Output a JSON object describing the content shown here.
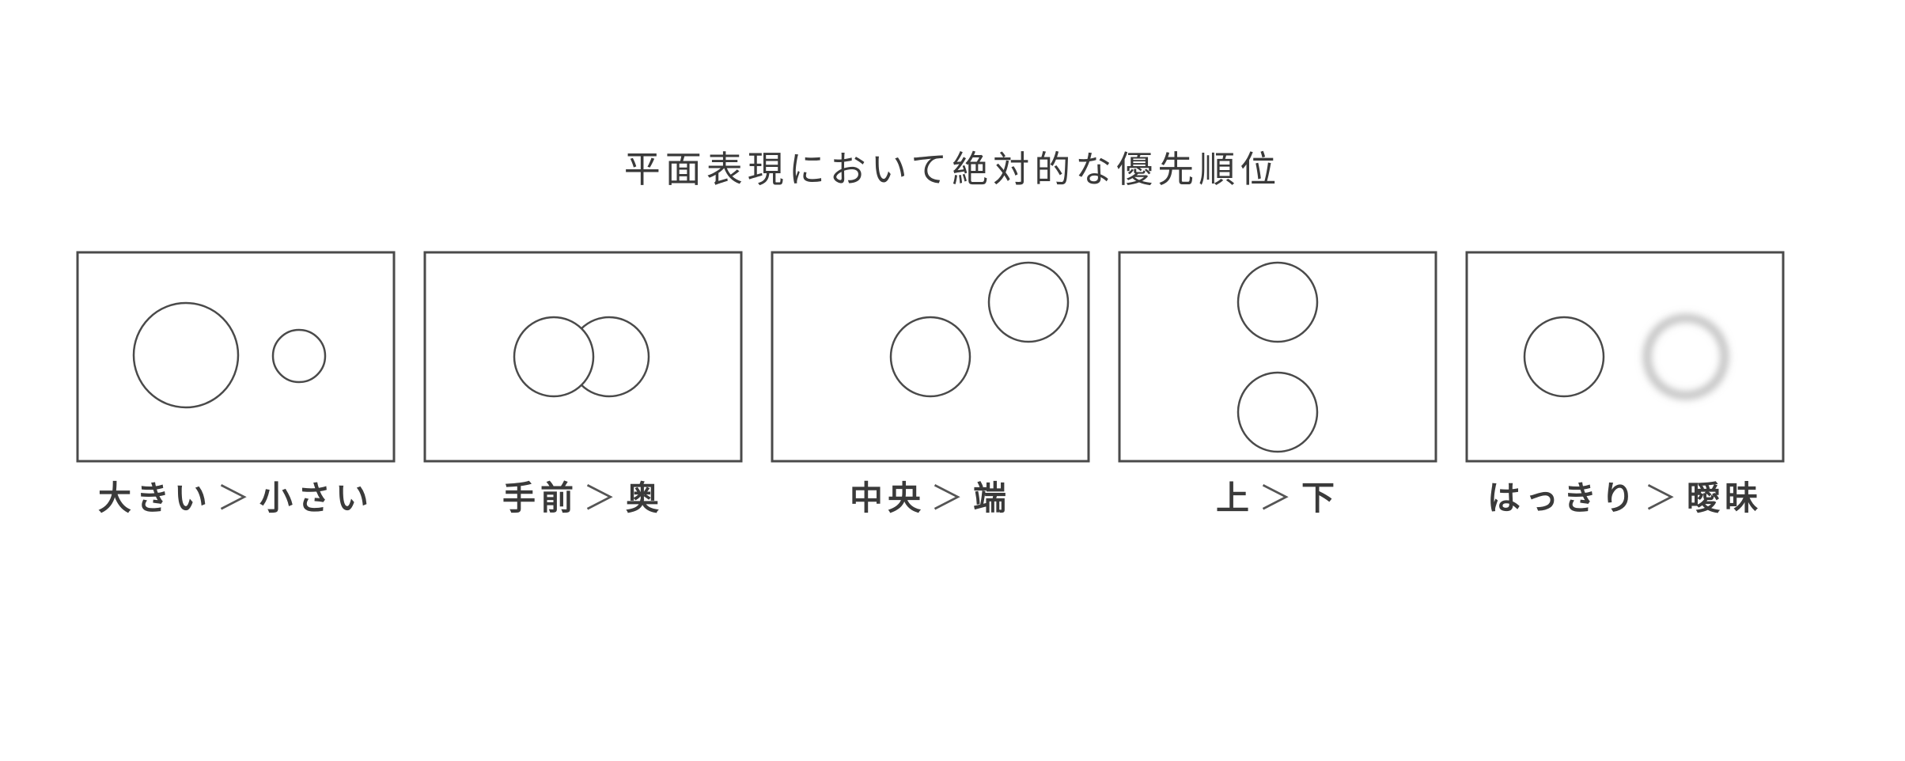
{
  "title": "平面表現において絶対的な優先順位",
  "colors": {
    "stroke": "#4a4a4a",
    "text": "#3a3a3a",
    "background": "#ffffff"
  },
  "panels": [
    {
      "left": "大きい",
      "separator": "＞",
      "right": "小さい"
    },
    {
      "left": "手前",
      "separator": "＞",
      "right": "奥"
    },
    {
      "left": "中央",
      "separator": "＞",
      "right": "端"
    },
    {
      "left": "上",
      "separator": "＞",
      "right": "下"
    },
    {
      "left": "はっきり",
      "separator": "＞",
      "right": "曖昧"
    }
  ]
}
